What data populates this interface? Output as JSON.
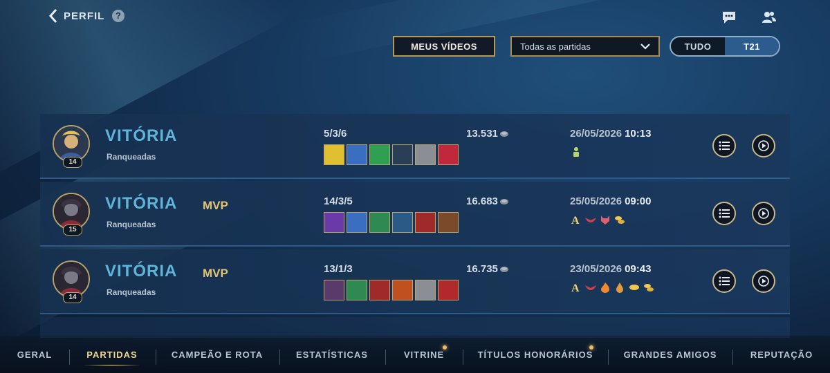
{
  "header": {
    "title": "PERFIL",
    "help_label": "?",
    "chat_icon": "chat-bubble-icon",
    "friends_icon": "friends-icon"
  },
  "controls": {
    "videos_button": "MEUS VÍDEOS",
    "filter_select": "Todas as partidas",
    "toggle": [
      "TUDO",
      "T21"
    ],
    "toggle_active": "T21"
  },
  "matches": [
    {
      "result": "VITÓRIA",
      "mode": "Ranqueadas",
      "level": "14",
      "mvp": "",
      "kda": "5/3/6",
      "gold": "13.531",
      "date": "26/05/2026",
      "time": "10:13",
      "items": [
        "#e0c030",
        "#3a6ec0",
        "#2fa052",
        "#2a3f55",
        "#8a8f95",
        "#c0283c"
      ],
      "medals": [
        "figure-medal-icon"
      ]
    },
    {
      "result": "VITÓRIA",
      "mode": "Ranqueadas",
      "level": "15",
      "mvp": "MVP",
      "kda": "14/3/5",
      "gold": "16.683",
      "date": "25/05/2026",
      "time": "09:00",
      "items": [
        "#6a3aa8",
        "#3a6ec0",
        "#2f8a52",
        "#2a5a85",
        "#a02a2a",
        "#7a4a2a"
      ],
      "medals": [
        "a-medal-icon",
        "wings-medal-icon",
        "demon-medal-icon",
        "coins-medal-icon"
      ]
    },
    {
      "result": "VITÓRIA",
      "mode": "Ranqueadas",
      "level": "14",
      "mvp": "MVP",
      "kda": "13/1/3",
      "gold": "16.735",
      "date": "23/05/2026",
      "time": "09:43",
      "items": [
        "#5a3a6a",
        "#2f8a52",
        "#a02a2a",
        "#c05020",
        "#8a8f95",
        "#b02a2a"
      ],
      "medals": [
        "a-medal-icon",
        "wings-medal-icon",
        "flame-medal-icon",
        "drop-medal-icon",
        "coin-medal-icon",
        "coins-medal-icon"
      ]
    }
  ],
  "tabs": [
    "GERAL",
    "PARTIDAS",
    "CAMPEÃO E ROTA",
    "ESTATÍSTICAS",
    "VITRINE",
    "TÍTULOS HONORÁRIOS",
    "GRANDES AMIGOS",
    "REPUTAÇÃO"
  ],
  "active_tab": "PARTIDAS"
}
